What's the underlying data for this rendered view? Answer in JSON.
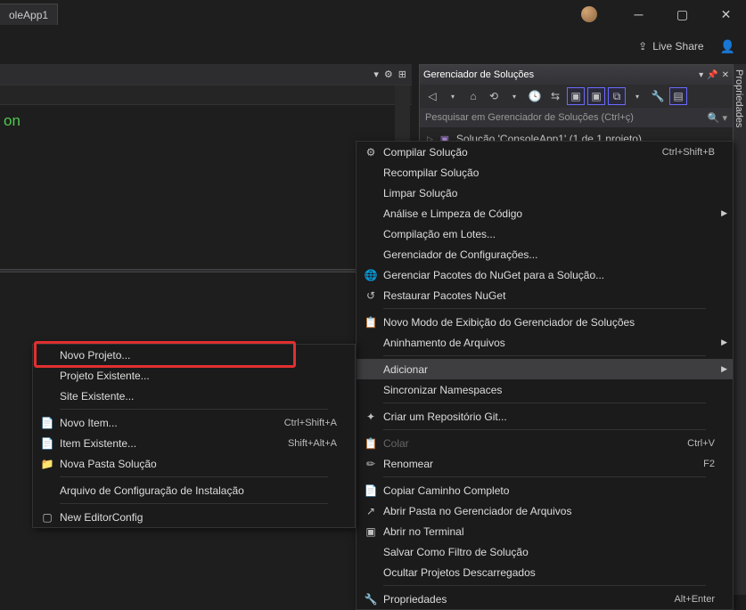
{
  "titlebar": {
    "app_tab": "oleApp1"
  },
  "toolbar": {
    "live_share": "Live Share"
  },
  "editor": {
    "code_fragment": "on"
  },
  "side_tab": {
    "label": "Propriedades"
  },
  "solution_explorer": {
    "title": "Gerenciador de Soluções",
    "search_placeholder": "Pesquisar em Gerenciador de Soluções (Ctrl+ç)",
    "solution_node": "Solução 'ConsoleApp1' (1 de 1 projeto)"
  },
  "main_menu": {
    "items": [
      {
        "icon": "⚙",
        "label": "Compilar Solução",
        "accel": "Ctrl+Shift+B"
      },
      {
        "icon": "",
        "label": "Recompilar Solução"
      },
      {
        "icon": "",
        "label": "Limpar Solução"
      },
      {
        "icon": "",
        "label": "Análise e Limpeza de Código",
        "submenu": true
      },
      {
        "icon": "",
        "label": "Compilação em Lotes..."
      },
      {
        "icon": "",
        "label": "Gerenciador de Configurações..."
      },
      {
        "icon": "🌐",
        "label": "Gerenciar Pacotes do NuGet para a Solução..."
      },
      {
        "icon": "↺",
        "label": "Restaurar Pacotes NuGet"
      },
      {
        "sep": true
      },
      {
        "icon": "📋",
        "label": "Novo Modo de Exibição do Gerenciador de Soluções"
      },
      {
        "icon": "",
        "label": "Aninhamento de Arquivos",
        "submenu": true
      },
      {
        "sep": true
      },
      {
        "icon": "",
        "label": "Adicionar",
        "submenu": true,
        "highlighted": true
      },
      {
        "icon": "",
        "label": "Sincronizar Namespaces"
      },
      {
        "sep": true
      },
      {
        "icon": "✦",
        "label": "Criar um Repositório Git..."
      },
      {
        "sep": true
      },
      {
        "icon": "📋",
        "label": "Colar",
        "accel": "Ctrl+V",
        "disabled": true
      },
      {
        "icon": "✏",
        "label": "Renomear",
        "accel": "F2"
      },
      {
        "sep": true
      },
      {
        "icon": "📄",
        "label": "Copiar Caminho Completo"
      },
      {
        "icon": "↗",
        "label": "Abrir Pasta no Gerenciador de Arquivos"
      },
      {
        "icon": "▣",
        "label": "Abrir no Terminal"
      },
      {
        "icon": "",
        "label": "Salvar Como Filtro de Solução"
      },
      {
        "icon": "",
        "label": "Ocultar Projetos Descarregados"
      },
      {
        "sep": true
      },
      {
        "icon": "🔧",
        "label": "Propriedades",
        "accel": "Alt+Enter"
      }
    ]
  },
  "sub_menu": {
    "items": [
      {
        "icon": "",
        "label": "Novo Projeto...",
        "boxed": true
      },
      {
        "icon": "",
        "label": "Projeto Existente..."
      },
      {
        "icon": "",
        "label": "Site Existente..."
      },
      {
        "sep": true
      },
      {
        "icon": "📄",
        "label": "Novo Item...",
        "accel": "Ctrl+Shift+A"
      },
      {
        "icon": "📄",
        "label": "Item Existente...",
        "accel": "Shift+Alt+A"
      },
      {
        "icon": "📁",
        "label": "Nova Pasta Solução"
      },
      {
        "sep": true
      },
      {
        "icon": "",
        "label": "Arquivo de Configuração de Instalação"
      },
      {
        "sep": true
      },
      {
        "icon": "▢",
        "label": "New EditorConfig"
      }
    ]
  }
}
